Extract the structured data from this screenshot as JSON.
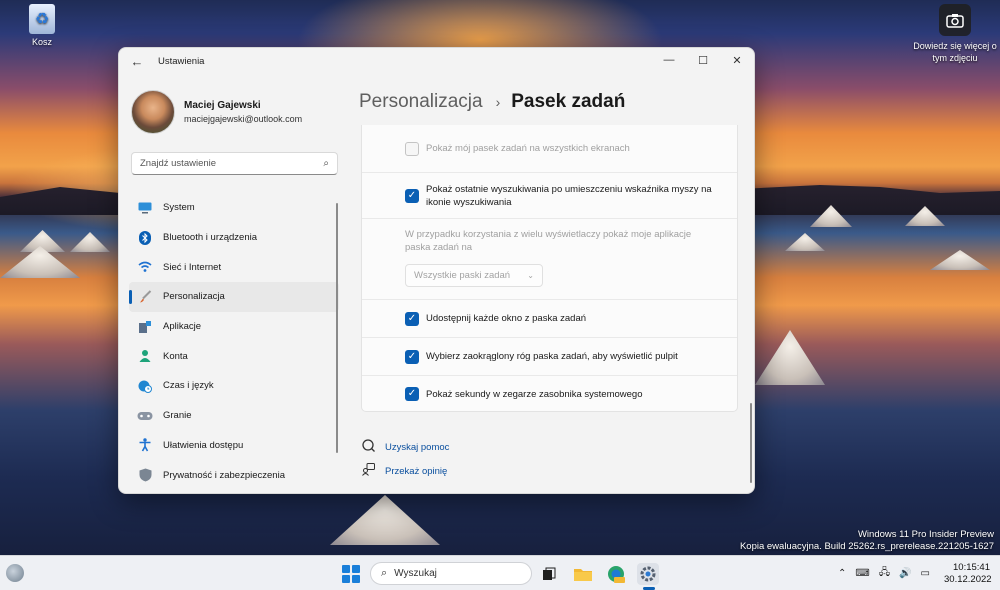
{
  "desktop": {
    "recycle_bin_label": "Kosz",
    "learn_more_label": "Dowiedz się więcej o tym zdjęciu",
    "watermark_line1": "Windows 11 Pro Insider Preview",
    "watermark_line2": "Kopia ewaluacyjna. Build 25262.rs_prerelease.221205-1627"
  },
  "window": {
    "title": "Ustawienia",
    "controls": {
      "minimize": "—",
      "maximize": "☐",
      "close": "✕"
    }
  },
  "profile": {
    "name": "Maciej Gajewski",
    "email": "maciejgajewski@outlook.com"
  },
  "search": {
    "placeholder": "Znajdź ustawienie"
  },
  "sidebar": {
    "items": [
      {
        "label": "System",
        "icon": "monitor-icon",
        "color": "#2d8fd8"
      },
      {
        "label": "Bluetooth i urządzenia",
        "icon": "bluetooth-icon",
        "color": "#0a5fb4"
      },
      {
        "label": "Sieć i Internet",
        "icon": "wifi-icon",
        "color": "#1f72d1"
      },
      {
        "label": "Personalizacja",
        "icon": "brush-icon",
        "color": "#d9652e",
        "active": true
      },
      {
        "label": "Aplikacje",
        "icon": "apps-icon",
        "color": "#5a6f8a"
      },
      {
        "label": "Konta",
        "icon": "account-icon",
        "color": "#1ea37a"
      },
      {
        "label": "Czas i język",
        "icon": "globe-clock-icon",
        "color": "#1f86d1"
      },
      {
        "label": "Granie",
        "icon": "gamepad-icon",
        "color": "#7a8594"
      },
      {
        "label": "Ułatwienia dostępu",
        "icon": "accessibility-icon",
        "color": "#1f72d1"
      },
      {
        "label": "Prywatność i zabezpieczenia",
        "icon": "shield-icon",
        "color": "#6f7b88"
      }
    ]
  },
  "breadcrumb": {
    "parent": "Personalizacja",
    "separator": "›",
    "current": "Pasek zadań"
  },
  "settings": {
    "show_taskbar_all_displays": {
      "label": "Pokaż mój pasek zadań na wszystkich ekranach",
      "checked": false,
      "disabled": true
    },
    "show_recent_searches": {
      "label": "Pokaż ostatnie wyszukiwania po umieszczeniu wskaźnika myszy na ikonie wyszukiwania",
      "checked": true
    },
    "multi_display_text": "W przypadku korzystania z wielu wyświetlaczy pokaż moje aplikacje paska zadań na",
    "multi_display_dropdown": "Wszystkie paski zadań",
    "share_any_window": {
      "label": "Udostępnij każde okno z paska zadań",
      "checked": true
    },
    "far_corner_desktop": {
      "label": "Wybierz zaokrąglony róg paska zadań, aby wyświetlić pulpit",
      "checked": true
    },
    "show_seconds": {
      "label": "Pokaż sekundy w zegarze zasobnika systemowego",
      "checked": true
    }
  },
  "help": {
    "get_help": "Uzyskaj pomoc",
    "give_feedback": "Przekaż opinię"
  },
  "taskbar": {
    "search_placeholder": "Wyszukaj",
    "time": "10:15:41",
    "date": "30.12.2022",
    "accent": "#0a5fb4"
  }
}
